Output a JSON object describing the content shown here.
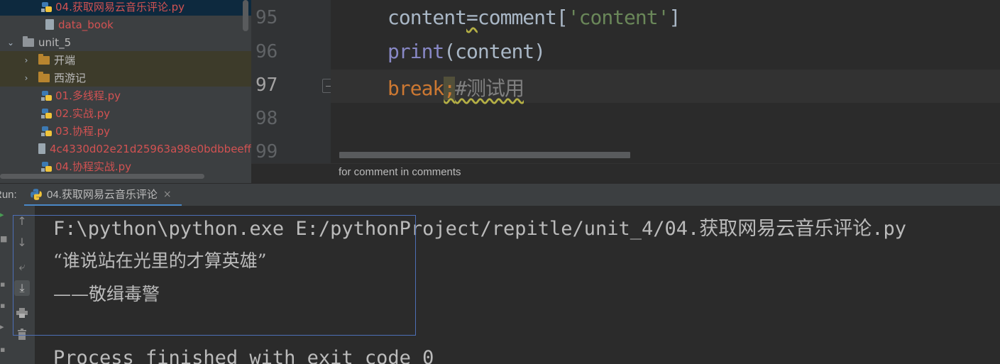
{
  "project_tree": {
    "items": [
      {
        "label": "04.获取网易云音乐评论.py",
        "type": "py",
        "state": "selected"
      },
      {
        "label": "data_book",
        "type": "file"
      },
      {
        "label": "unit_5",
        "type": "folder",
        "expanded": true
      },
      {
        "label": "开端",
        "type": "folder",
        "expanded": false
      },
      {
        "label": "西游记",
        "type": "folder",
        "expanded": false
      },
      {
        "label": "01.多线程.py",
        "type": "py"
      },
      {
        "label": "02.实战.py",
        "type": "py"
      },
      {
        "label": "03.协程.py",
        "type": "py"
      },
      {
        "label": "4c4330d02e21d25963a98e0bdbbeeff",
        "type": "file"
      },
      {
        "label": "04.协程实战.py",
        "type": "py"
      }
    ]
  },
  "editor": {
    "line_numbers": [
      "95",
      "96",
      "97",
      "98",
      "99"
    ],
    "current_line": "97",
    "lines": {
      "l95": {
        "var": "content",
        "eq": "=",
        "obj": "comment",
        "lb": "[",
        "str": "'content'",
        "rb": "]"
      },
      "l96": {
        "fn": "print",
        "args": "(content)"
      },
      "l97": {
        "kw": "break",
        "semi": ";",
        "comment": "#测试用"
      }
    },
    "breadcrumb": "for comment in comments"
  },
  "run_panel": {
    "label": "Run:",
    "tab_label": "04.获取网易云音乐评论",
    "tab_close": "×",
    "console_lines": [
      "F:\\python\\python.exe E:/pythonProject/repitle/unit_4/04.获取网易云音乐评论.py",
      "“谁说站在光里的才算英雄”",
      "——敬缉毒警",
      "",
      "Process finished with exit code 0"
    ]
  },
  "colors": {
    "keyword": "#cc7832",
    "string": "#6a8759",
    "builtin": "#8888c6",
    "comment": "#808080",
    "file_error": "#d25252"
  }
}
